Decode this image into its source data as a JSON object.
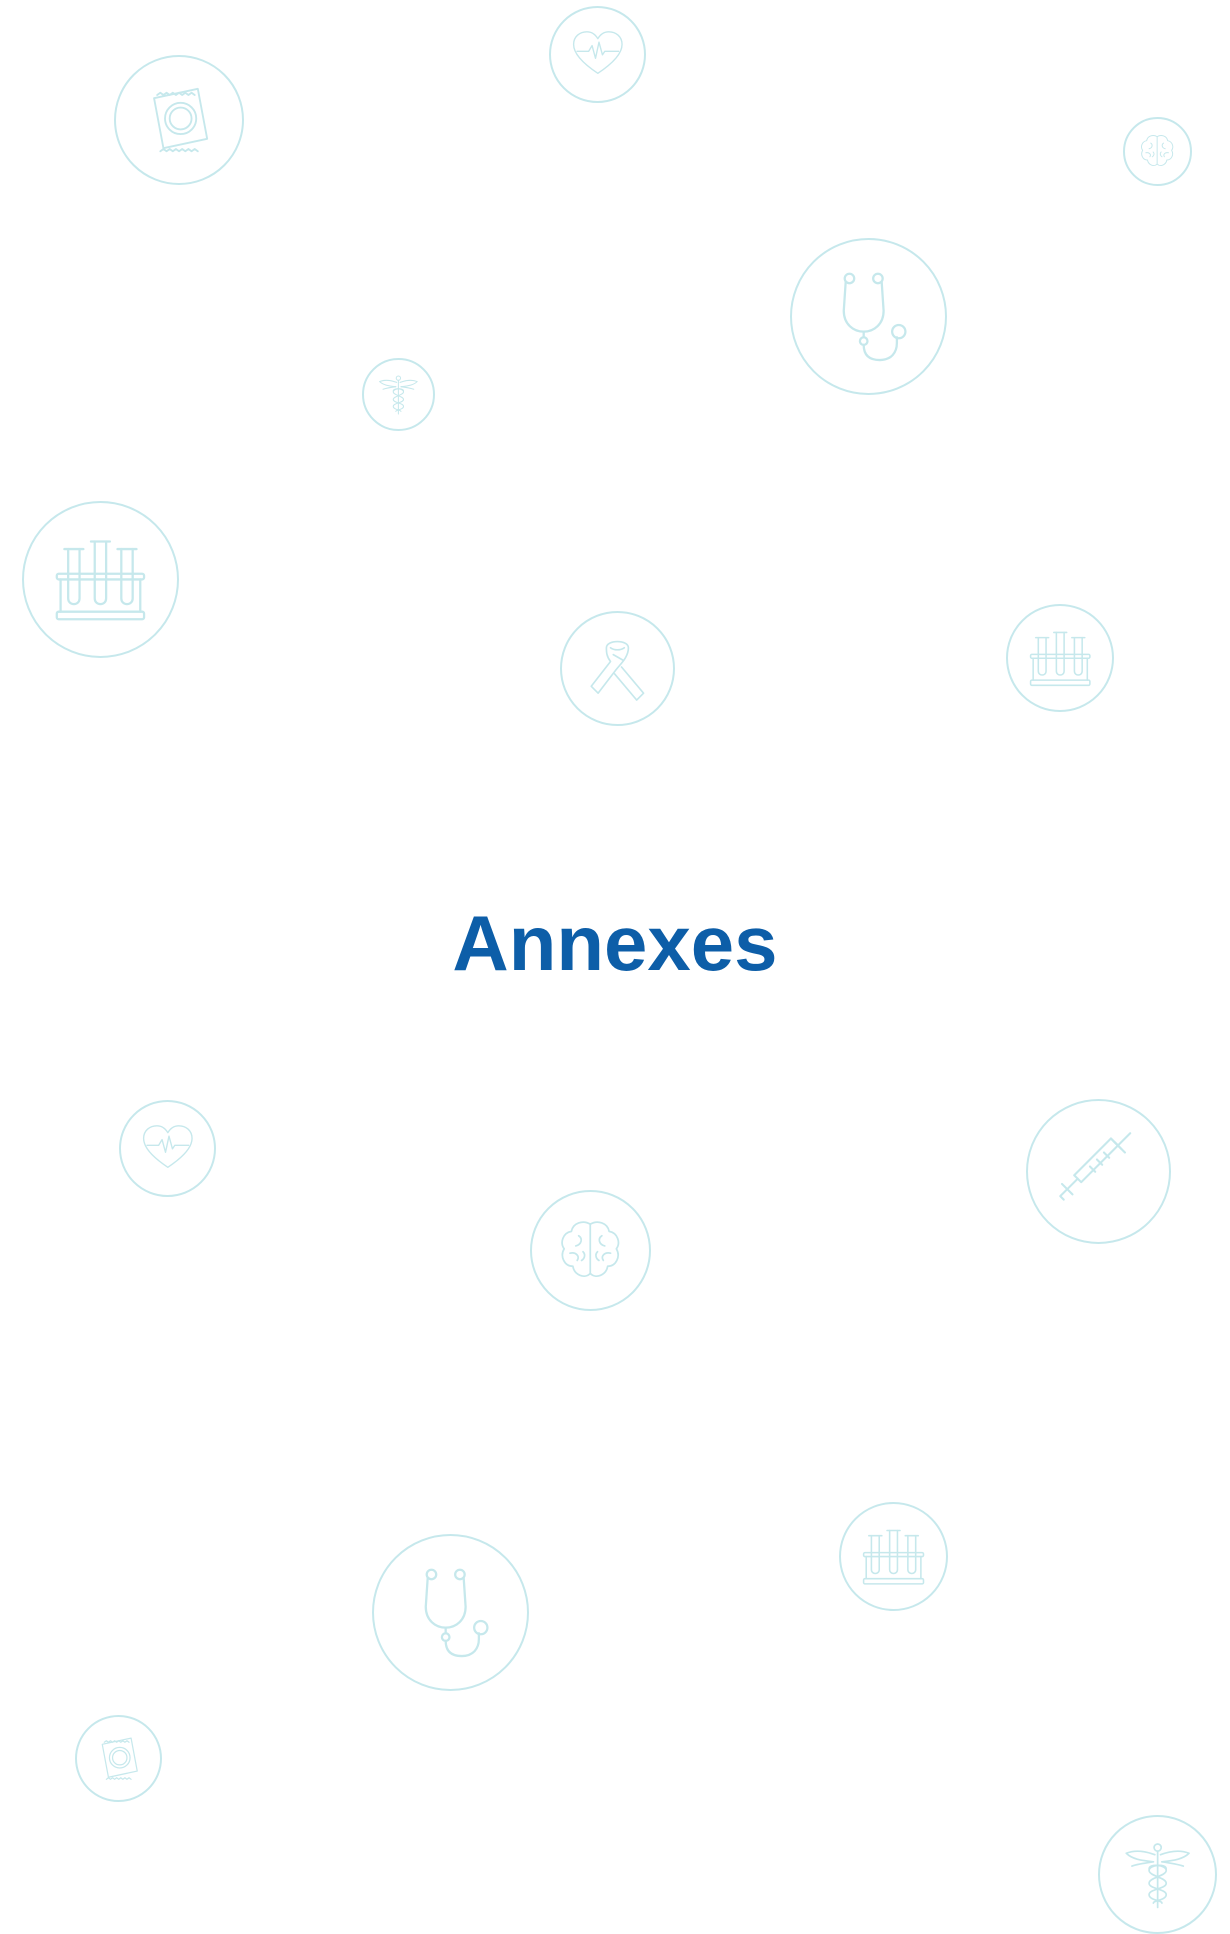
{
  "page": {
    "title": "Annexes",
    "title_color": "#0d5ea8",
    "icon_color": "#c6e8ec",
    "background": "#ffffff"
  },
  "decorations": [
    "condom-icon",
    "heart-pulse-icon",
    "brain-icon",
    "stethoscope-icon",
    "caduceus-icon",
    "test-tubes-icon",
    "awareness-ribbon-icon",
    "test-tubes-icon",
    "heart-pulse-icon",
    "syringe-icon",
    "brain-icon",
    "test-tubes-icon",
    "stethoscope-icon",
    "condom-icon",
    "caduceus-icon"
  ]
}
